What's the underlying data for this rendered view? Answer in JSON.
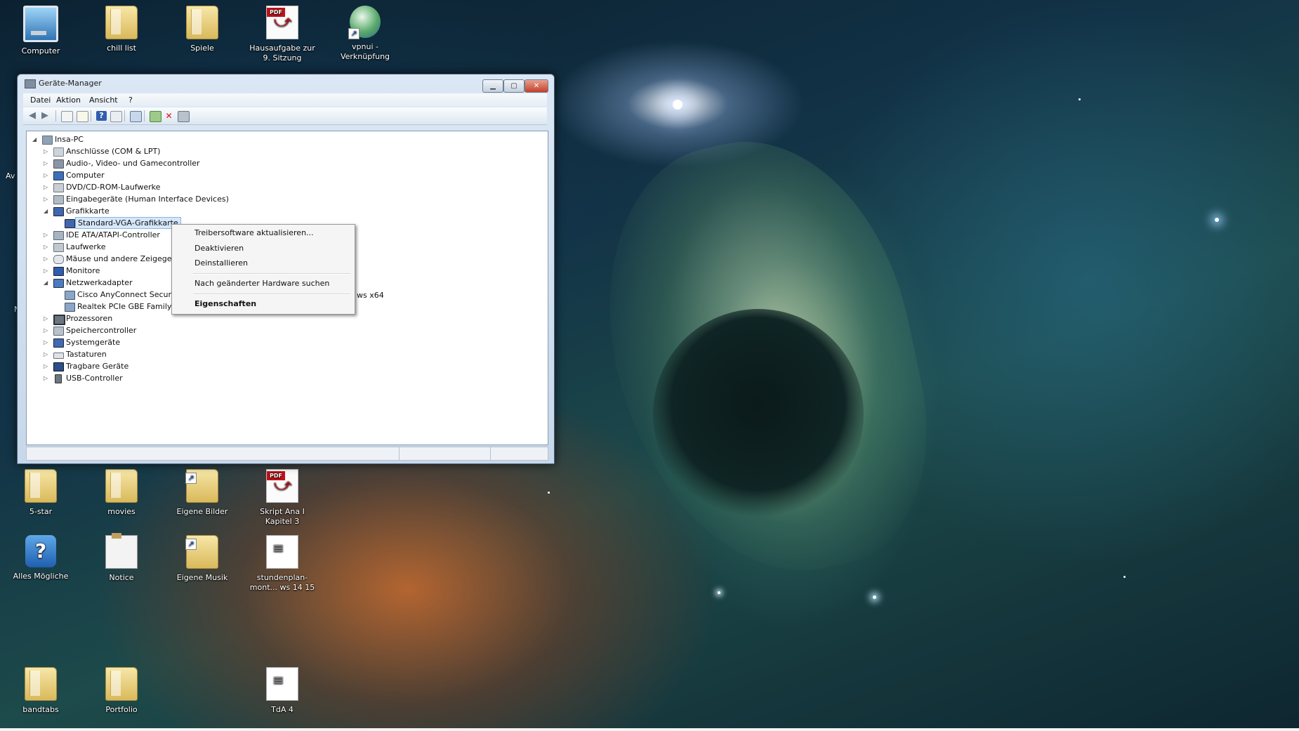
{
  "desktop": {
    "icons_top": [
      {
        "label": "Computer",
        "icon": "computer-icon"
      },
      {
        "label": "chill list",
        "icon": "folder-icon"
      },
      {
        "label": "Spiele",
        "icon": "folder-icon"
      },
      {
        "label": "Hausaufgabe zur 9. Sitzung",
        "icon": "pdf-file-icon"
      },
      {
        "label": "vpnui - Verknüpfung",
        "icon": "vpn-globe-icon"
      }
    ],
    "icons_bottom": [
      {
        "label": "5-star",
        "icon": "folder-icon"
      },
      {
        "label": "movies",
        "icon": "folder-icon"
      },
      {
        "label": "Eigene Bilder",
        "icon": "folder-icon"
      },
      {
        "label": "Skript Ana I Kapitel 3",
        "icon": "pdf-file-icon"
      },
      {
        "label": "Alles Mögliche",
        "icon": "help-icon"
      },
      {
        "label": "Notice",
        "icon": "clipboard-icon"
      },
      {
        "label": "Eigene Musik",
        "icon": "folder-icon"
      },
      {
        "label": "stundenplan-mont... ws 14 15",
        "icon": "document-icon"
      },
      {
        "label": "bandtabs",
        "icon": "folder-icon"
      },
      {
        "label": "Portfolio",
        "icon": "folder-icon"
      },
      {
        "label": "TdA 4",
        "icon": "document-icon"
      }
    ],
    "edge_fragments": {
      "left_av": "Av",
      "left_n": "N"
    }
  },
  "window": {
    "title": "Geräte-Manager",
    "menu": [
      "Datei",
      "Aktion",
      "Ansicht",
      "?"
    ],
    "toolbar_icons": [
      "back-arrow-icon",
      "forward-arrow-icon",
      "show-hide-console-tree-icon",
      "properties-icon",
      "help-icon",
      "show-hide-action-pane-icon",
      "scan-hardware-icon",
      "update-driver-icon",
      "uninstall-icon",
      "disable-device-icon"
    ],
    "tree": {
      "root": "Insa-PC",
      "nodes": [
        {
          "label": "Anschlüsse (COM & LPT)",
          "icon": "port-icon",
          "expanded": false
        },
        {
          "label": "Audio-, Video- und Gamecontroller",
          "icon": "speaker-icon",
          "expanded": false
        },
        {
          "label": "Computer",
          "icon": "computer-icon",
          "expanded": false
        },
        {
          "label": "DVD/CD-ROM-Laufwerke",
          "icon": "dvd-drive-icon",
          "expanded": false
        },
        {
          "label": "Eingabegeräte (Human Interface Devices)",
          "icon": "hid-icon",
          "expanded": false
        },
        {
          "label": "Grafikkarte",
          "icon": "display-adapter-icon",
          "expanded": true
        },
        {
          "label": "Standard-VGA-Grafikkarte",
          "icon": "display-adapter-icon",
          "child": true,
          "selected": true
        },
        {
          "label": "IDE ATA/ATAPI-Controller",
          "icon": "ide-controller-icon",
          "expanded": false
        },
        {
          "label": "Laufwerke",
          "icon": "disk-drive-icon",
          "expanded": false
        },
        {
          "label": "Mäuse und andere Zeigegeräte",
          "icon": "mouse-icon",
          "expanded": false
        },
        {
          "label": "Monitore",
          "icon": "monitor-icon",
          "expanded": false
        },
        {
          "label": "Netzwerkadapter",
          "icon": "network-adapter-icon",
          "expanded": true
        },
        {
          "label": "Cisco AnyConnect Secur",
          "icon": "network-adapter-icon",
          "child": true
        },
        {
          "label": "Realtek PCIe GBE Family",
          "icon": "network-adapter-icon",
          "child": true
        },
        {
          "label": "Prozessoren",
          "icon": "processor-icon",
          "expanded": false
        },
        {
          "label": "Speichercontroller",
          "icon": "storage-controller-icon",
          "expanded": false
        },
        {
          "label": "Systemgeräte",
          "icon": "system-devices-icon",
          "expanded": false
        },
        {
          "label": "Tastaturen",
          "icon": "keyboard-icon",
          "expanded": false
        },
        {
          "label": "Tragbare Geräte",
          "icon": "portable-device-icon",
          "expanded": false
        },
        {
          "label": "USB-Controller",
          "icon": "usb-icon",
          "expanded": false
        }
      ],
      "overflow_text": "ws x64"
    },
    "context_menu": [
      {
        "label": "Treibersoftware aktualisieren..."
      },
      {
        "label": "Deaktivieren"
      },
      {
        "label": "Deinstallieren"
      },
      {
        "label": "Nach geänderter Hardware suchen"
      },
      {
        "label": "Eigenschaften",
        "bold": true
      }
    ]
  },
  "colors": {
    "selection": "#d5e7fa",
    "pdf_red": "#c4121a",
    "titlebar": "#c7d8ea"
  }
}
